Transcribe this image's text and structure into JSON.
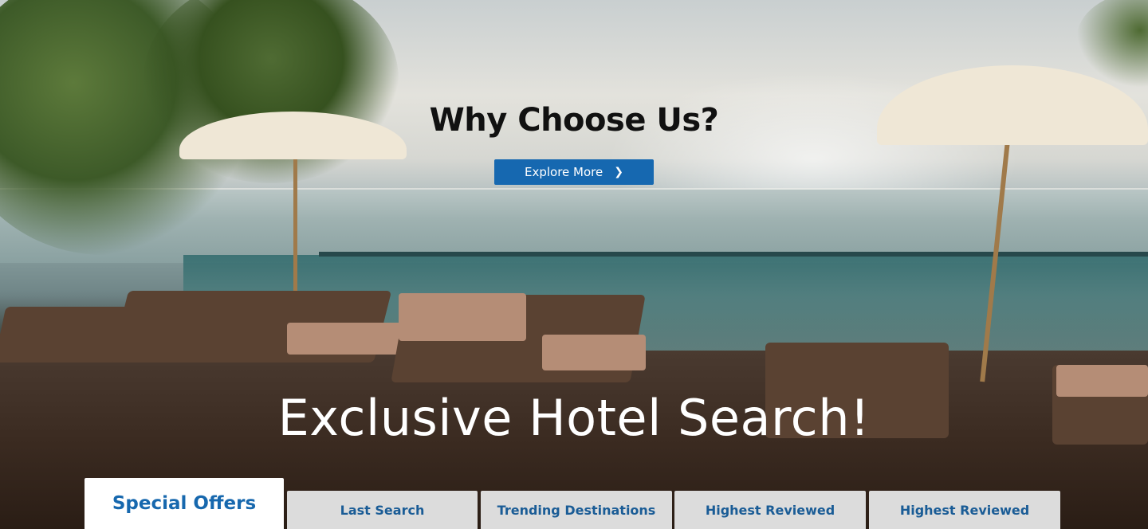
{
  "hero": {
    "heading": "Why Choose Us?",
    "explore_button": "Explore More",
    "title": "Exclusive Hotel Search!"
  },
  "tabs": [
    {
      "label": "Special Offers",
      "active": true
    },
    {
      "label": "Last Search",
      "active": false
    },
    {
      "label": "Trending Destinations",
      "active": false
    },
    {
      "label": "Highest Reviewed",
      "active": false
    },
    {
      "label": "Highest Reviewed",
      "active": false
    }
  ],
  "colors": {
    "primary_blue": "#1668b0",
    "tab_text": "#1a5c96",
    "tab_bg": "#dcdcdc",
    "active_tab_bg": "#ffffff"
  }
}
